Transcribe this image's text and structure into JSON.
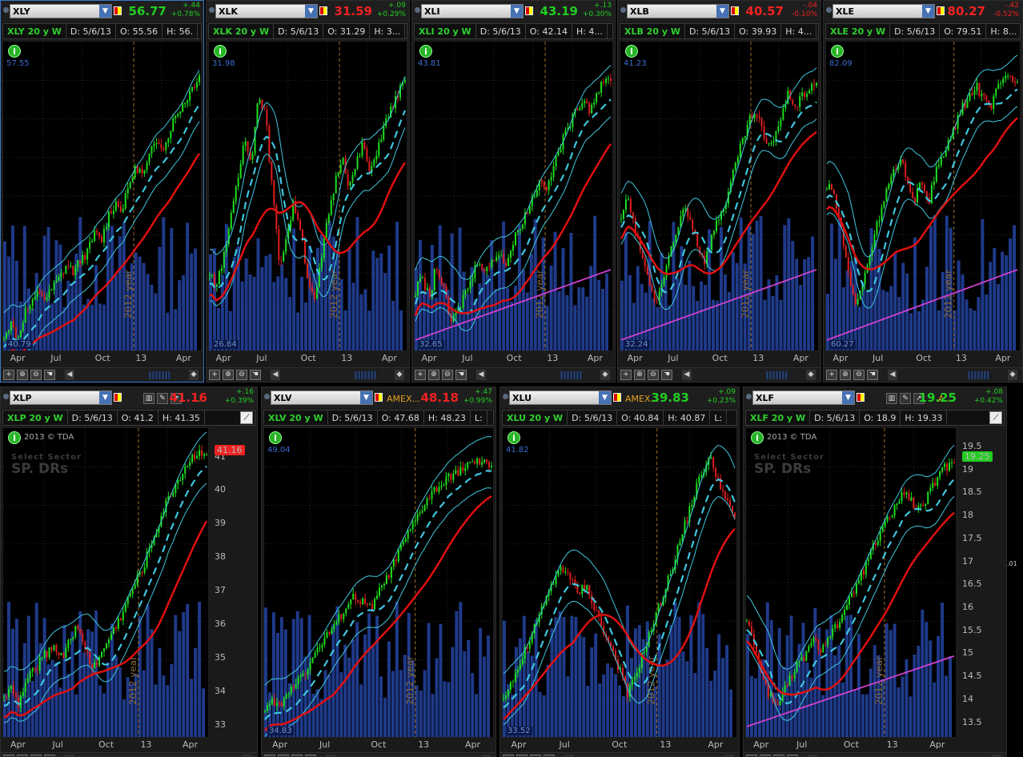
{
  "layout_note": "",
  "colors": {
    "up": "#1ee11e",
    "down": "#e11e1e",
    "ma_dashed": "#3ec8e0",
    "ma_red": "#e01010",
    "ma_magenta": "#d040d0",
    "bands": "#40c8e0",
    "volume": "#1f3a8a",
    "pos": "#22cc22",
    "neg": "#ee2222"
  },
  "panels": [
    {
      "id": "xly",
      "symbol": "XLY",
      "last": "56.77",
      "chg": "+.44",
      "pct": "+0.78%",
      "dir": "pos",
      "active": true,
      "info": [
        "XLY 20 y W",
        "D: 5/6/13",
        "O: 55.56",
        "H: 56."
      ],
      "top_label": "57.55",
      "bot_label": "40.79",
      "xaxis": [
        "Apr",
        "Jul",
        "Oct",
        "13",
        "Apr"
      ]
    },
    {
      "id": "xlk",
      "symbol": "XLK",
      "last": "31.59",
      "chg": "+.09",
      "pct": "+0.29%",
      "dir": "neg",
      "info": [
        "XLK 20 y W",
        "D: 5/6/13",
        "O: 31.29",
        "H: 3..."
      ],
      "top_label": "31.98",
      "bot_label": "26.84",
      "xaxis": [
        "Apr",
        "Jul",
        "Oct",
        "13",
        "Apr"
      ]
    },
    {
      "id": "xli",
      "symbol": "XLI",
      "last": "43.19",
      "chg": "+.13",
      "pct": "+0.30%",
      "dir": "pos",
      "info": [
        "XLI 20 y W",
        "D: 5/6/13",
        "O: 42.14",
        "H: 4..."
      ],
      "top_label": "43.81",
      "bot_label": "32.65",
      "xaxis": [
        "Apr",
        "Jul",
        "Oct",
        "13",
        "Apr"
      ]
    },
    {
      "id": "xlb",
      "symbol": "XLB",
      "last": "40.57",
      "chg": "-.04",
      "pct": "-0.10%",
      "dir": "neg",
      "info": [
        "XLB 20 y W",
        "D: 5/6/13",
        "O: 39.93",
        "H: 4..."
      ],
      "top_label": "41.23",
      "bot_label": "32.24",
      "xaxis": [
        "Apr",
        "Jul",
        "Oct",
        "13",
        "Apr"
      ]
    },
    {
      "id": "xle",
      "symbol": "XLE",
      "last": "80.27",
      "chg": "-.42",
      "pct": "-0.52%",
      "dir": "neg",
      "info": [
        "XLE 20 y W",
        "D: 5/6/13",
        "O: 79.51",
        "H: 8..."
      ],
      "top_label": "82.09",
      "bot_label": "60.27",
      "xaxis": [
        "Apr",
        "Jul",
        "Oct",
        "13",
        "Apr"
      ]
    },
    {
      "id": "xlp",
      "symbol": "XLP",
      "last": "41.16",
      "chg": "+.16",
      "pct": "+0.39%",
      "dir": "neg",
      "exch": "...",
      "info": [
        "XLP 20 y W",
        "D: 5/6/13",
        "O: 41.2",
        "H: 41.35"
      ],
      "copyright": "2013 © TDA",
      "watermark": [
        "Select Sector",
        "SP. DRs"
      ],
      "yticks": [
        "41",
        "40",
        "39",
        "38",
        "37",
        "36",
        "35",
        "34",
        "33"
      ],
      "price_tag": "41.16",
      "xaxis": [
        "Apr",
        "Jul",
        "Oct",
        "13",
        "Apr"
      ]
    },
    {
      "id": "xlv",
      "symbol": "XLV",
      "last": "48.18",
      "chg": "+.47",
      "pct": "+0.99%",
      "dir": "neg",
      "exch": "AMEX...",
      "info": [
        "XLV 20 y W",
        "D: 5/6/13",
        "O: 47.68",
        "H: 48.23",
        "L:"
      ],
      "top_label": "49.04",
      "bot_label": "34.83",
      "xaxis": [
        "Apr",
        "Jul",
        "Oct",
        "13",
        "Apr"
      ]
    },
    {
      "id": "xlu",
      "symbol": "XLU",
      "last": "39.83",
      "chg": "+.09",
      "pct": "+0.23%",
      "dir": "pos",
      "exch": "AMEX...",
      "info": [
        "XLU 20 y W",
        "D: 5/6/13",
        "O: 40.84",
        "H: 40.87",
        "L:"
      ],
      "top_label": "41.82",
      "bot_label": "33.52",
      "xaxis": [
        "Apr",
        "Jul",
        "Oct",
        "13",
        "Apr"
      ]
    },
    {
      "id": "xlf",
      "symbol": "XLF",
      "last": "19.25",
      "chg": "+.08",
      "pct": "+0.42%",
      "dir": "pos",
      "exch": "A...",
      "info": [
        "XLF 20 y W",
        "D: 5/6/13",
        "O: 18.9",
        "H: 19.33"
      ],
      "copyright": "2013 © TDA",
      "watermark": [
        "Select Sector",
        "SP. DRs"
      ],
      "yticks": [
        "19.5",
        "19",
        "18.5",
        "18",
        "17.5",
        "17",
        "16.5",
        "16",
        "15.5",
        "15",
        "14.5",
        "14",
        "13.5"
      ],
      "price_tag": "19.25",
      "xaxis": [
        "Apr",
        "Jul",
        "Oct",
        "13",
        "Apr"
      ]
    }
  ],
  "year_label": "2012 year",
  "side_fragment": ".01",
  "chart_data": [
    {
      "type": "line",
      "title": "XLY 20 y W",
      "ylim": [
        40.79,
        57.55
      ],
      "series": [
        {
          "values": [
            41.5,
            42.1,
            41.2,
            42.8,
            43.2,
            44.0,
            43.5,
            44.2,
            44.8,
            45.6,
            45.1,
            45.9,
            46.3,
            47.4,
            47.0,
            48.5,
            49.2,
            48.8,
            50.4,
            51.3,
            50.8,
            52.1,
            53.0,
            52.4,
            53.8,
            54.6,
            55.2,
            56.0,
            56.77
          ]
        }
      ]
    },
    {
      "type": "line",
      "title": "XLK 20 y W",
      "ylim": [
        26.84,
        31.98
      ],
      "series": [
        {
          "values": [
            28.2,
            27.9,
            28.5,
            29.1,
            29.8,
            30.6,
            30.2,
            31.4,
            31.0,
            29.6,
            28.3,
            28.8,
            29.4,
            29.0,
            28.1,
            27.6,
            28.4,
            29.2,
            29.8,
            30.3,
            29.7,
            30.1,
            30.5,
            29.9,
            30.4,
            30.8,
            31.1,
            31.4,
            31.59
          ]
        }
      ]
    },
    {
      "type": "line",
      "title": "XLI 20 y W",
      "ylim": [
        32.65,
        43.81
      ],
      "series": [
        {
          "values": [
            34.8,
            35.3,
            34.5,
            35.8,
            34.9,
            33.6,
            33.9,
            34.7,
            35.2,
            36.1,
            35.6,
            35.9,
            36.4,
            35.8,
            36.7,
            37.4,
            37.9,
            38.6,
            39.2,
            38.8,
            39.9,
            40.6,
            41.3,
            41.8,
            42.4,
            41.9,
            42.6,
            42.9,
            43.19
          ]
        }
      ]
    },
    {
      "type": "line",
      "title": "XLB 20 y W",
      "ylim": [
        32.24,
        41.23
      ],
      "series": [
        {
          "values": [
            36.4,
            36.9,
            35.8,
            35.1,
            34.2,
            33.6,
            34.3,
            35.1,
            35.8,
            36.7,
            36.2,
            35.4,
            34.9,
            35.7,
            36.3,
            36.8,
            37.6,
            38.4,
            39.1,
            39.6,
            39.2,
            38.4,
            38.9,
            39.5,
            40.2,
            39.8,
            40.1,
            40.4,
            40.57
          ]
        }
      ]
    },
    {
      "type": "line",
      "title": "XLE 20 y W",
      "ylim": [
        60.27,
        82.09
      ],
      "series": [
        {
          "values": [
            72.5,
            71.8,
            69.4,
            66.1,
            63.5,
            64.8,
            66.7,
            68.9,
            70.4,
            72.6,
            73.8,
            74.5,
            72.1,
            71.6,
            72.8,
            71.4,
            73.5,
            74.8,
            75.9,
            77.3,
            78.6,
            79.4,
            80.1,
            79.2,
            78.5,
            79.8,
            80.6,
            80.9,
            80.27
          ]
        }
      ]
    },
    {
      "type": "line",
      "title": "XLP 20 y W",
      "ylim": [
        32.8,
        41.3
      ],
      "series": [
        {
          "values": [
            33.8,
            34.1,
            33.6,
            34.3,
            34.6,
            34.9,
            35.2,
            35.4,
            35.0,
            35.6,
            35.9,
            35.5,
            34.8,
            34.9,
            35.4,
            35.8,
            36.2,
            36.7,
            37.2,
            37.6,
            38.2,
            38.8,
            39.4,
            39.9,
            40.3,
            40.7,
            41.0,
            41.2,
            41.16
          ]
        }
      ]
    },
    {
      "type": "line",
      "title": "XLV 20 y W",
      "ylim": [
        34.83,
        49.04
      ],
      "series": [
        {
          "values": [
            35.8,
            36.4,
            36.1,
            36.9,
            37.5,
            37.9,
            38.6,
            39.3,
            39.8,
            40.4,
            41.1,
            41.6,
            41.3,
            41.0,
            41.7,
            42.5,
            43.3,
            44.2,
            44.9,
            45.7,
            46.4,
            46.9,
            47.2,
            47.6,
            47.9,
            48.1,
            48.3,
            48.2,
            48.18
          ]
        }
      ]
    },
    {
      "type": "line",
      "title": "XLU 20 y W",
      "ylim": [
        33.52,
        41.82
      ],
      "series": [
        {
          "values": [
            34.6,
            35.0,
            35.5,
            36.1,
            36.7,
            37.3,
            37.9,
            38.4,
            38.0,
            37.6,
            37.8,
            37.2,
            36.5,
            36.0,
            35.4,
            34.6,
            35.2,
            35.9,
            36.6,
            37.3,
            38.0,
            38.8,
            39.6,
            40.4,
            41.1,
            41.5,
            40.9,
            40.2,
            39.83
          ]
        }
      ]
    },
    {
      "type": "line",
      "title": "XLF 20 y W",
      "ylim": [
        13.3,
        19.5
      ],
      "series": [
        {
          "values": [
            15.8,
            15.2,
            14.6,
            14.1,
            13.9,
            14.2,
            14.5,
            14.8,
            15.0,
            15.3,
            15.1,
            15.4,
            15.6,
            15.8,
            16.2,
            16.6,
            16.9,
            17.3,
            17.6,
            17.9,
            18.2,
            18.5,
            18.4,
            18.1,
            18.3,
            18.6,
            18.9,
            19.1,
            19.25
          ]
        }
      ]
    }
  ]
}
